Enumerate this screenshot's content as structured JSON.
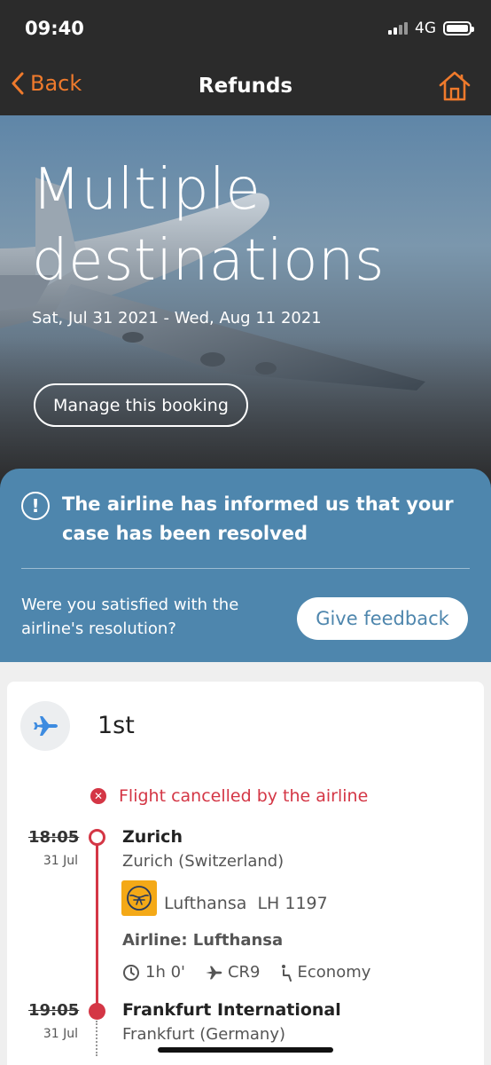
{
  "status": {
    "time": "09:40",
    "network": "4G"
  },
  "nav": {
    "back_label": "Back",
    "title": "Refunds"
  },
  "hero": {
    "title_line1": "Multiple",
    "title_line2": "destinations",
    "dates": "Sat, Jul 31 2021 - Wed, Aug 11 2021",
    "manage_label": "Manage this booking"
  },
  "notice": {
    "message": "The airline has informed us that your case has been resolved",
    "question": "Were you satisfied with the airline's resolution?",
    "feedback_label": "Give feedback"
  },
  "flight": {
    "leg": "1st",
    "status": "Flight cancelled by the airline",
    "departure": {
      "time": "18:05",
      "date": "31 Jul",
      "city": "Zurich",
      "airport": "Zurich (Switzerland)"
    },
    "carrier": {
      "name": "Lufthansa",
      "flight_no": "LH 1197",
      "airline_label": "Airline: Lufthansa"
    },
    "duration": "1h 0'",
    "aircraft": "CR9",
    "cabin": "Economy",
    "arrival": {
      "time": "19:05",
      "date": "31 Jul",
      "city": "Frankfurt International",
      "airport": "Frankfurt (Germany)"
    }
  },
  "colors": {
    "accent": "#ef7a2c",
    "notice_bg": "#4e86ad",
    "danger": "#d43645",
    "topbar": "#2b2b2b"
  }
}
